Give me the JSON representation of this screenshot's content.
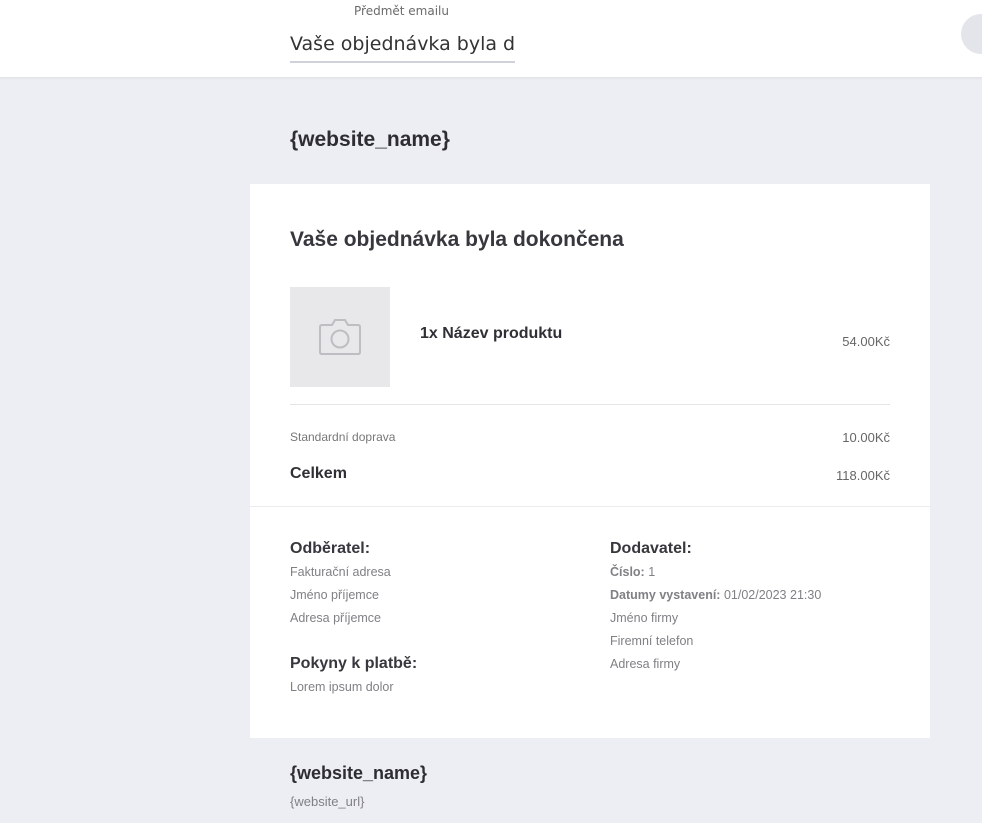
{
  "header": {
    "subject_label": "Předmět emailu",
    "subject_value": "Vaše objednávka byla dol"
  },
  "email": {
    "site_name": "{website_name}",
    "heading": "Vaše objednávka byla dokončena",
    "product": {
      "name": "1x Název produktu",
      "price": "54.00Kč",
      "image_icon": "camera-icon"
    },
    "shipping": {
      "label": "Standardní doprava",
      "price": "10.00Kč"
    },
    "total": {
      "label": "Celkem",
      "price": "118.00Kč"
    },
    "customer": {
      "heading": "Odběratel:",
      "lines": [
        "Fakturační adresa",
        "Jméno příjemce",
        "Adresa příjemce"
      ]
    },
    "payment": {
      "heading": "Pokyny k platbě:",
      "text": "Lorem ipsum dolor"
    },
    "supplier": {
      "heading": "Dodavatel:",
      "number_label": "Číslo:",
      "number_value": "1",
      "date_label": "Datumy vystavení:",
      "date_value": "01/02/2023 21:30",
      "company_name": "Jméno firmy",
      "company_phone": "Firemní telefon",
      "company_address": "Adresa firmy"
    }
  },
  "footer": {
    "site_name": "{website_name}",
    "site_url": "{website_url}"
  }
}
